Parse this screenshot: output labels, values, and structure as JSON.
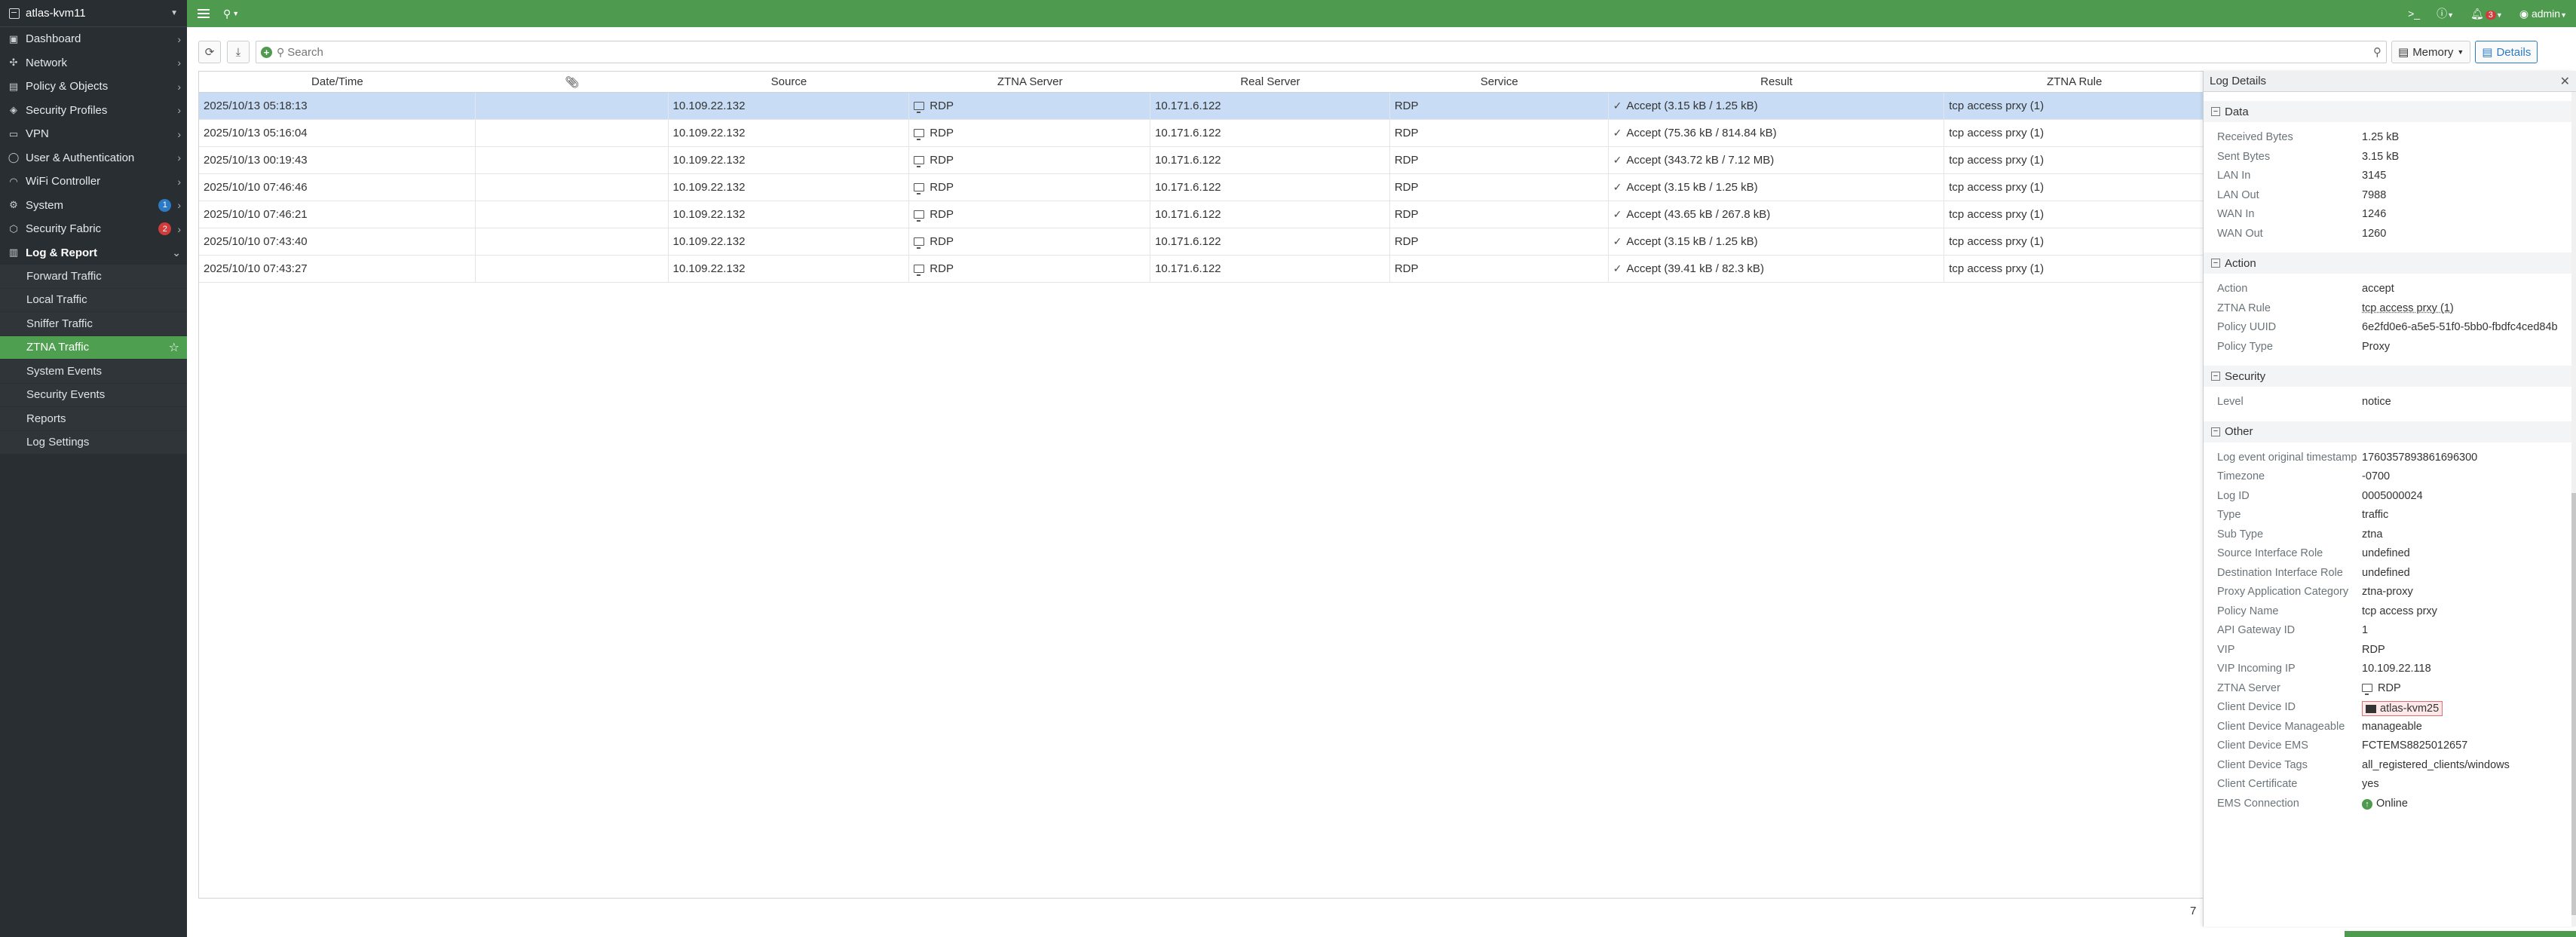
{
  "sidebar": {
    "device": "atlas-kvm11",
    "items": [
      {
        "label": "Dashboard",
        "icon": "dashboard-icon"
      },
      {
        "label": "Network",
        "icon": "network-icon"
      },
      {
        "label": "Policy & Objects",
        "icon": "policy-icon"
      },
      {
        "label": "Security Profiles",
        "icon": "security-profiles-icon"
      },
      {
        "label": "VPN",
        "icon": "vpn-icon"
      },
      {
        "label": "User & Authentication",
        "icon": "user-icon"
      },
      {
        "label": "WiFi Controller",
        "icon": "wifi-icon"
      },
      {
        "label": "System",
        "icon": "gear-icon",
        "badge": "1"
      },
      {
        "label": "Security Fabric",
        "icon": "fabric-icon",
        "badge": "2"
      },
      {
        "label": "Log & Report",
        "icon": "chart-icon"
      }
    ],
    "sub_items": [
      {
        "label": "Forward Traffic"
      },
      {
        "label": "Local Traffic"
      },
      {
        "label": "Sniffer Traffic"
      },
      {
        "label": "ZTNA Traffic"
      },
      {
        "label": "System Events"
      },
      {
        "label": "Security Events"
      },
      {
        "label": "Reports"
      },
      {
        "label": "Log Settings"
      }
    ]
  },
  "topbar": {
    "notifications": "3",
    "user": "admin"
  },
  "toolbar": {
    "search_placeholder": "Search",
    "memory_label": "Memory",
    "details_label": "Details"
  },
  "table": {
    "columns": [
      "Date/Time",
      "",
      "Source",
      "ZTNA Server",
      "Real Server",
      "Service",
      "Result",
      "ZTNA Rule"
    ],
    "rows": [
      {
        "datetime": "2025/10/13 05:18:13",
        "source": "10.109.22.132",
        "ztna": "RDP",
        "real": "10.171.6.122",
        "service": "RDP",
        "result": "Accept (3.15 kB / 1.25 kB)",
        "rule": "tcp access prxy (1)"
      },
      {
        "datetime": "2025/10/13 05:16:04",
        "source": "10.109.22.132",
        "ztna": "RDP",
        "real": "10.171.6.122",
        "service": "RDP",
        "result": "Accept (75.36 kB / 814.84 kB)",
        "rule": "tcp access prxy (1)"
      },
      {
        "datetime": "2025/10/13 00:19:43",
        "source": "10.109.22.132",
        "ztna": "RDP",
        "real": "10.171.6.122",
        "service": "RDP",
        "result": "Accept (343.72 kB / 7.12 MB)",
        "rule": "tcp access prxy (1)"
      },
      {
        "datetime": "2025/10/10 07:46:46",
        "source": "10.109.22.132",
        "ztna": "RDP",
        "real": "10.171.6.122",
        "service": "RDP",
        "result": "Accept (3.15 kB / 1.25 kB)",
        "rule": "tcp access prxy (1)"
      },
      {
        "datetime": "2025/10/10 07:46:21",
        "source": "10.109.22.132",
        "ztna": "RDP",
        "real": "10.171.6.122",
        "service": "RDP",
        "result": "Accept (43.65 kB / 267.8 kB)",
        "rule": "tcp access prxy (1)"
      },
      {
        "datetime": "2025/10/10 07:43:40",
        "source": "10.109.22.132",
        "ztna": "RDP",
        "real": "10.171.6.122",
        "service": "RDP",
        "result": "Accept (3.15 kB / 1.25 kB)",
        "rule": "tcp access prxy (1)"
      },
      {
        "datetime": "2025/10/10 07:43:27",
        "source": "10.109.22.132",
        "ztna": "RDP",
        "real": "10.171.6.122",
        "service": "RDP",
        "result": "Accept (39.41 kB / 82.3 kB)",
        "rule": "tcp access prxy (1)"
      }
    ],
    "row_count": "7"
  },
  "details": {
    "title": "Log Details",
    "sections": [
      {
        "title": "Data",
        "fields": [
          {
            "k": "Received Bytes",
            "v": "1.25 kB"
          },
          {
            "k": "Sent Bytes",
            "v": "3.15 kB"
          },
          {
            "k": "LAN In",
            "v": "3145"
          },
          {
            "k": "LAN Out",
            "v": "7988"
          },
          {
            "k": "WAN In",
            "v": "1246"
          },
          {
            "k": "WAN Out",
            "v": "1260"
          }
        ]
      },
      {
        "title": "Action",
        "fields": [
          {
            "k": "Action",
            "v": "accept"
          },
          {
            "k": "ZTNA Rule",
            "v": "tcp access prxy (1)"
          },
          {
            "k": "Policy UUID",
            "v": "6e2fd0e6-a5e5-51f0-5bb0-fbdfc4ced84b"
          },
          {
            "k": "Policy Type",
            "v": "Proxy"
          }
        ]
      },
      {
        "title": "Security",
        "fields": [
          {
            "k": "Level",
            "v": "notice"
          }
        ]
      },
      {
        "title": "Other",
        "fields": [
          {
            "k": "Log event original timestamp",
            "v": "1760357893861696300"
          },
          {
            "k": "Timezone",
            "v": "-0700"
          },
          {
            "k": "Log ID",
            "v": "0005000024"
          },
          {
            "k": "Type",
            "v": "traffic"
          },
          {
            "k": "Sub Type",
            "v": "ztna"
          },
          {
            "k": "Source Interface Role",
            "v": "undefined"
          },
          {
            "k": "Destination Interface Role",
            "v": "undefined"
          },
          {
            "k": "Proxy Application Category",
            "v": "ztna-proxy"
          },
          {
            "k": "Policy Name",
            "v": "tcp access prxy"
          },
          {
            "k": "API Gateway ID",
            "v": "1"
          },
          {
            "k": "VIP",
            "v": "RDP"
          },
          {
            "k": "VIP Incoming IP",
            "v": "10.109.22.118"
          },
          {
            "k": "ZTNA Server",
            "v": "RDP"
          },
          {
            "k": "Client Device ID",
            "v": "atlas-kvm25"
          },
          {
            "k": "Client Device Manageable",
            "v": "manageable"
          },
          {
            "k": "Client Device EMS",
            "v": "FCTEMS8825012657"
          },
          {
            "k": "Client Device Tags",
            "v": "all_registered_clients/windows"
          },
          {
            "k": "Client Certificate",
            "v": "yes"
          },
          {
            "k": "EMS Connection",
            "v": "Online"
          }
        ]
      }
    ]
  }
}
